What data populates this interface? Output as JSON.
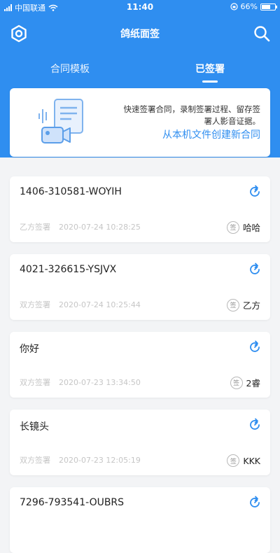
{
  "status_bar": {
    "carrier": "中国联通",
    "time": "11:40",
    "battery": "66%",
    "battery_level": 0.66
  },
  "navbar": {
    "title": "鸽纸面签"
  },
  "tabs": [
    {
      "label": "合同模板",
      "active": false
    },
    {
      "label": "已签署",
      "active": true
    }
  ],
  "banner": {
    "description": "快速签署合同，录制签署过程、留存签署人影音证据。",
    "link_text": "从本机文件创建新合同"
  },
  "contracts": [
    {
      "title": "1406-310581-WOYIH",
      "party": "乙方签署",
      "date": "2020-07-24 10:28:25",
      "sign_badge": "签",
      "signer": "哈哈"
    },
    {
      "title": "4021-326615-YSJVX",
      "party": "双方签署",
      "date": "2020-07-24 10:25:44",
      "sign_badge": "签",
      "signer": "乙方"
    },
    {
      "title": "你好",
      "party": "双方签署",
      "date": "2020-07-23 13:34:50",
      "sign_badge": "签",
      "signer": "2睿"
    },
    {
      "title": "长镜头",
      "party": "双方签署",
      "date": "2020-07-23 12:05:19",
      "sign_badge": "签",
      "signer": "KKK"
    },
    {
      "title": "7296-793541-OUBRS",
      "party": "",
      "date": "",
      "sign_badge": "",
      "signer": ""
    }
  ],
  "colors": {
    "primary": "#2f8ef0",
    "background": "#f3f4f6",
    "meta_text": "#c6c6c6"
  }
}
